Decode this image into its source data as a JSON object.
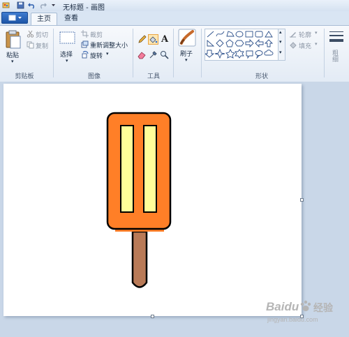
{
  "window": {
    "title": "无标题 - 画图"
  },
  "tabs": [
    {
      "label": "主页"
    },
    {
      "label": "查看"
    }
  ],
  "clipboard": {
    "paste_label": "粘贴",
    "cut_label": "剪切",
    "copy_label": "复制",
    "group_label": "剪贴板"
  },
  "image": {
    "select_label": "选择",
    "crop_label": "裁剪",
    "resize_label": "重新调整大小",
    "rotate_label": "旋转",
    "group_label": "图像"
  },
  "tools": {
    "group_label": "工具",
    "text_tool_glyph": "A"
  },
  "brushes": {
    "label": "刷子"
  },
  "shapes": {
    "group_label": "形状",
    "outline_label": "轮廓",
    "fill_label": "填充"
  },
  "size": {
    "label": "粗细"
  },
  "watermark": {
    "brand": "Baidu",
    "sub": "经验",
    "url": "jingyan.baidu.com"
  },
  "drawing": {
    "orange": "#ff7f27",
    "cream": "#ffff99",
    "stick": "#b97a57",
    "outline": "#000000"
  }
}
